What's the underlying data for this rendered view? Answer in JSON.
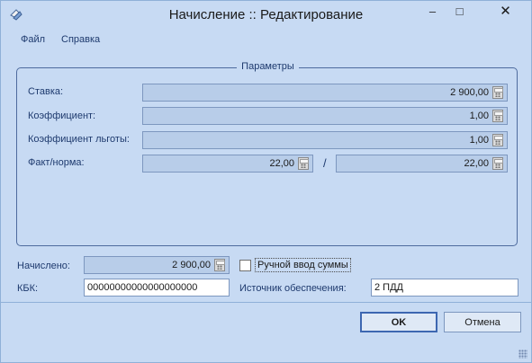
{
  "window": {
    "title": "Начисление :: Редактирование",
    "minimize_glyph": "–",
    "maximize_glyph": "□",
    "close_glyph": "✕"
  },
  "menu": {
    "items": [
      "Файл",
      "Справка"
    ]
  },
  "params": {
    "legend": "Параметры",
    "rate_label": "Ставка:",
    "rate_value": "2 900,00",
    "coef_label": "Коэффициент:",
    "coef_value": "1,00",
    "benefit_label": "Коэффициент льготы:",
    "benefit_value": "1,00",
    "fact_label": "Факт/норма:",
    "fact_value": "22,00",
    "fact_separator": "/",
    "norm_value": "22,00"
  },
  "summary": {
    "accrued_label": "Начислено:",
    "accrued_value": "2 900,00",
    "manual_label": "Ручной ввод суммы",
    "manual_checked": false,
    "kbk_label": "КБК:",
    "kbk_value": "00000000000000000000",
    "source_label": "Источник обеспечения:",
    "source_value": "2 ПДД"
  },
  "buttons": {
    "ok_label": "OK",
    "cancel_label": "Отмена"
  },
  "icons": {
    "app": "app-icon",
    "calculator": "calculator-icon",
    "resize": "resize-grip-icon"
  },
  "colors": {
    "background": "#c7daf3",
    "field_bg": "#b8cde9",
    "text_accent": "#1e3a6e",
    "ok_border": "#3d67b1"
  }
}
